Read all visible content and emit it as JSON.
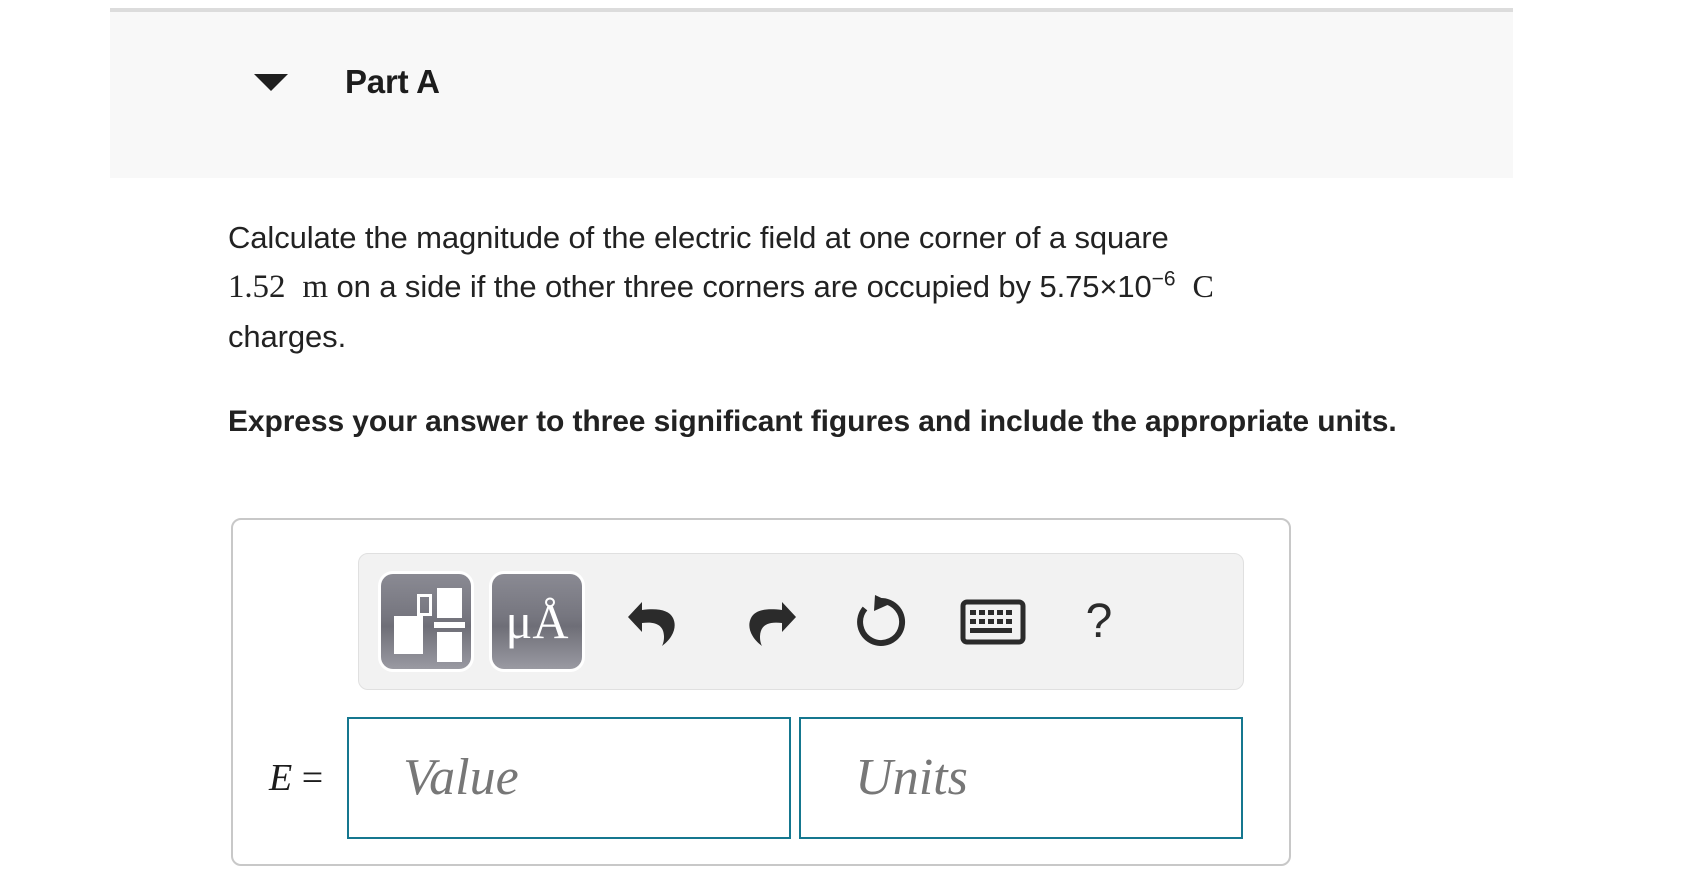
{
  "part": {
    "title": "Part A",
    "disclosure_icon": "triangle-down-icon",
    "expanded": true
  },
  "question": {
    "line1": "Calculate the magnitude of the electric field at one corner of a square",
    "line2_pre": "1.52",
    "line2_unit": "m",
    "line2_mid": "on a side if the other three corners are occupied by",
    "line2_value": "5.75×10",
    "line2_exponent": "−6",
    "line2_charge_unit": "C",
    "line3": "charges.",
    "instruction": "Express your answer to three significant figures and include the appropriate units."
  },
  "toolbar": {
    "buttons": [
      {
        "name": "math-template-button",
        "label": "",
        "icon": "math-template-icon",
        "tooltip": ""
      },
      {
        "name": "units-button",
        "label": "μÅ",
        "icon": "unit-symbol-icon",
        "tooltip": ""
      },
      {
        "name": "undo-button",
        "label": "",
        "icon": "undo-icon",
        "tooltip": ""
      },
      {
        "name": "redo-button",
        "label": "",
        "icon": "redo-icon",
        "tooltip": ""
      },
      {
        "name": "reset-button",
        "label": "",
        "icon": "reset-icon",
        "tooltip": ""
      },
      {
        "name": "keyboard-button",
        "label": "",
        "icon": "keyboard-icon",
        "tooltip": ""
      },
      {
        "name": "help-button",
        "label": "?",
        "icon": "question-mark-icon",
        "tooltip": ""
      }
    ]
  },
  "answer": {
    "equals_label": "E =",
    "value_placeholder": "Value",
    "units_placeholder": "Units",
    "value": "",
    "units": ""
  },
  "colors": {
    "field_border": "#15778f",
    "panel_border": "#c8c8c8",
    "header_bg": "#f8f8f8",
    "toolbar_bg": "#f2f2f2",
    "text": "#222222"
  }
}
